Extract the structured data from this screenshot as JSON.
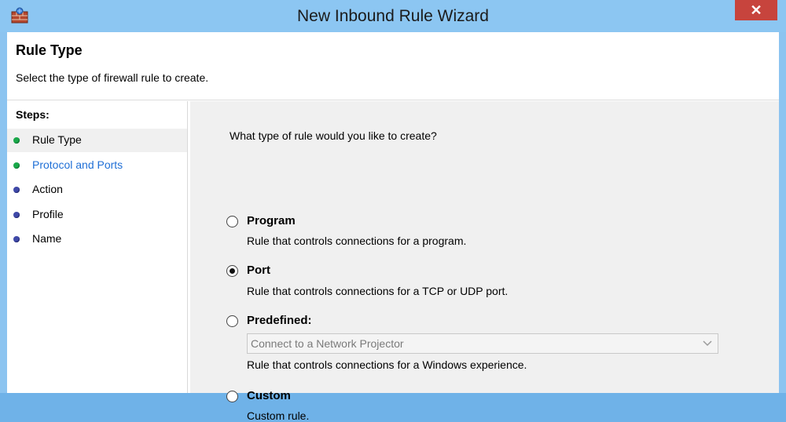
{
  "window": {
    "title": "New Inbound Rule Wizard",
    "close_glyph": "✕"
  },
  "header": {
    "title": "Rule Type",
    "description": "Select the type of firewall rule to create."
  },
  "steps": {
    "label": "Steps:",
    "items": [
      {
        "label": "Rule Type",
        "status": "green"
      },
      {
        "label": "Protocol and Ports",
        "status": "green"
      },
      {
        "label": "Action",
        "status": "blue"
      },
      {
        "label": "Profile",
        "status": "blue"
      },
      {
        "label": "Name",
        "status": "blue"
      }
    ]
  },
  "main": {
    "question": "What type of rule would you like to create?",
    "options": [
      {
        "label": "Program",
        "description": "Rule that controls connections for a program.",
        "selected": false
      },
      {
        "label": "Port",
        "description": "Rule that controls connections for a TCP or UDP port.",
        "selected": true
      },
      {
        "label": "Predefined:",
        "description": "Rule that controls connections for a Windows experience.",
        "selected": false,
        "select_value": "Connect to a Network Projector"
      },
      {
        "label": "Custom",
        "description": "Custom rule.",
        "selected": false
      }
    ]
  },
  "colors": {
    "titlebar": "#8cc6f2",
    "close": "#c7443d",
    "link": "#1f6fd6",
    "dot_green": "#1aa84a",
    "dot_blue": "#3f49a8"
  },
  "icons": {
    "app": "firewall-icon",
    "close": "close-icon",
    "dropdown": "chevron-down-icon"
  }
}
